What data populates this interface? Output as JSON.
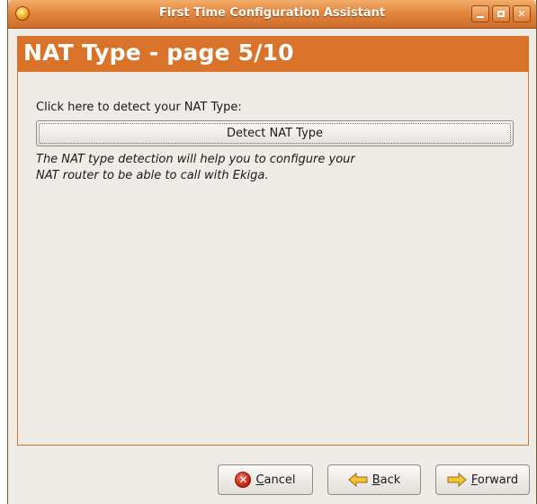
{
  "window": {
    "title": "First Time Configuration Assistant",
    "controls": [
      "minimize",
      "maximize",
      "close"
    ]
  },
  "page": {
    "title": "NAT Type - page 5/10",
    "prompt": "Click here to detect your NAT Type:",
    "detect_button_label": "Detect NAT Type",
    "description": "The NAT type detection will help you to configure your NAT router to be able to call with Ekiga."
  },
  "footer": {
    "cancel_mnemonic": "C",
    "cancel_rest": "ancel",
    "back_mnemonic": "B",
    "back_rest": "ack",
    "forward_mnemonic": "F",
    "forward_rest": "orward"
  },
  "icons": {
    "app": "ekiga-icon",
    "cancel": "cancel-icon",
    "back": "back-arrow-icon",
    "forward": "forward-arrow-icon"
  },
  "colors": {
    "accent": "#d9732a",
    "titlebar": "#e3873f",
    "background": "#efebe7"
  }
}
